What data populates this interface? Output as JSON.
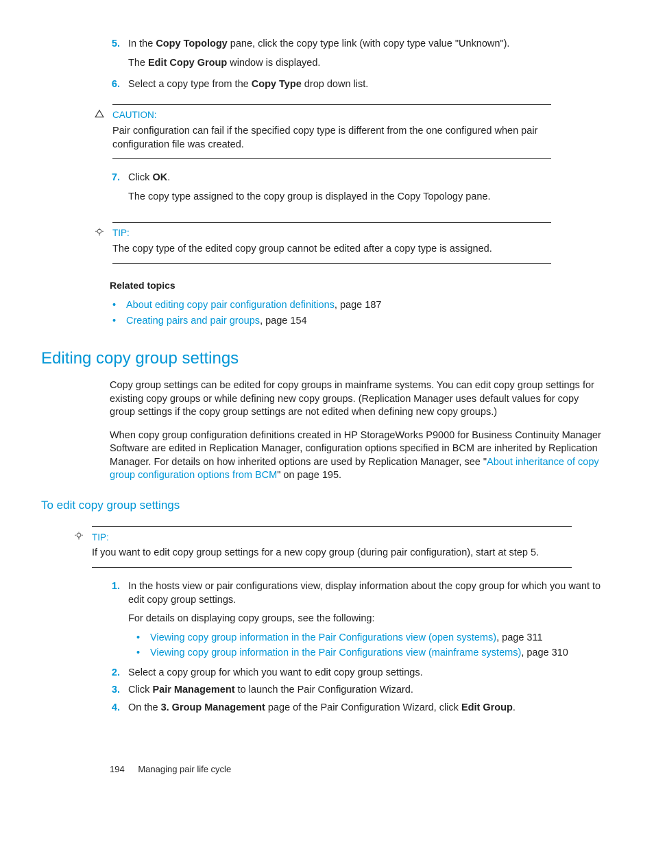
{
  "steps_a": {
    "s5": {
      "num": "5.",
      "text_pre": "In the ",
      "bold1": "Copy Topology",
      "text_mid": " pane, click the copy type link (with copy type value \"Unknown\").",
      "sub_pre": "The ",
      "sub_bold": "Edit Copy Group",
      "sub_post": " window is displayed."
    },
    "s6": {
      "num": "6.",
      "text_pre": "Select a copy type from the ",
      "bold1": "Copy Type",
      "text_post": " drop down list."
    }
  },
  "caution1": {
    "label": "CAUTION:",
    "body": "Pair configuration can fail if the specified copy type is different from the one configured when pair configuration file was created."
  },
  "steps_b": {
    "s7": {
      "num": "7.",
      "text_pre": "Click ",
      "bold1": "OK",
      "text_post": ".",
      "sub": "The copy type assigned to the copy group is displayed in the Copy Topology pane."
    }
  },
  "tip1": {
    "label": "TIP:",
    "body": "The copy type of the edited copy group cannot be edited after a copy type is assigned."
  },
  "related": {
    "heading": "Related topics",
    "items": [
      {
        "link": "About editing copy pair configuration definitions",
        "suffix": ", page 187"
      },
      {
        "link": "Creating pairs and pair groups",
        "suffix": ", page 154"
      }
    ]
  },
  "heading1": "Editing copy group settings",
  "para1": "Copy group settings can be edited for copy groups in mainframe systems. You can edit copy group settings for existing copy groups or while defining new copy groups. (Replication Manager uses default values for copy group settings if the copy group settings are not edited when defining new copy groups.)",
  "para2_pre": "When copy group configuration definitions created in HP StorageWorks P9000 for Business Continuity Manager Software are edited in Replication Manager, configuration options specified in BCM are inherited by Replication Manager. For details on how inherited options are used by Replication Manager, see \"",
  "para2_link": "About inheritance of copy group configuration options from BCM",
  "para2_post": "\" on page 195.",
  "heading2": "To edit copy group settings",
  "tip2": {
    "label": "TIP:",
    "body": "If you want to edit copy group settings for a new copy group (during pair configuration), start at step 5."
  },
  "steps_c": {
    "s1": {
      "num": "1.",
      "text": "In the hosts view or pair configurations view, display information about the copy group for which you want to edit copy group settings.",
      "sub": "For details on displaying copy groups, see the following:",
      "bullets": [
        {
          "link": "Viewing copy group information in the Pair Configurations view (open systems)",
          "suffix": ", page 311"
        },
        {
          "link": "Viewing copy group information in the Pair Configurations view (mainframe systems)",
          "suffix": ", page 310"
        }
      ]
    },
    "s2": {
      "num": "2.",
      "text": "Select a copy group for which you want to edit copy group settings."
    },
    "s3": {
      "num": "3.",
      "pre": "Click ",
      "bold": "Pair Management",
      "post": " to launch the Pair Configuration Wizard."
    },
    "s4": {
      "num": "4.",
      "pre": "On the ",
      "bold1": "3. Group Management",
      "mid": " page of the Pair Configuration Wizard, click ",
      "bold2": "Edit Group",
      "post": "."
    }
  },
  "footer": {
    "page": "194",
    "chapter": "Managing pair life cycle"
  }
}
